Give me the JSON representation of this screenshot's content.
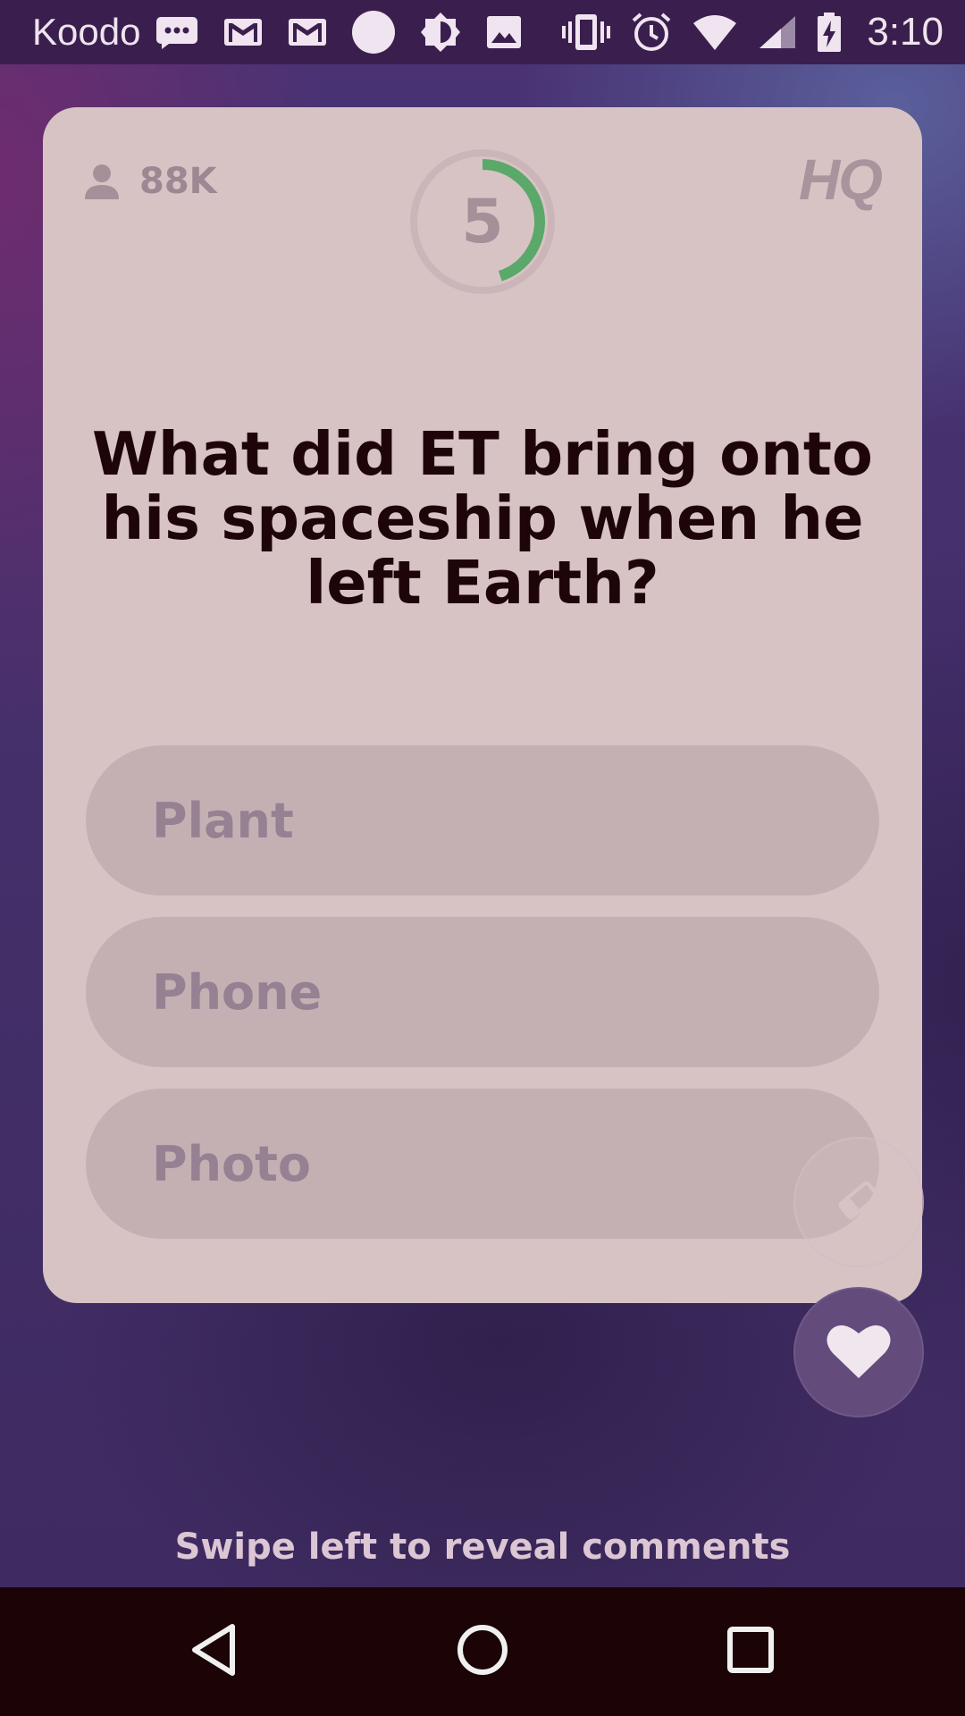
{
  "status_bar": {
    "carrier": "Koodo",
    "time": "3:10",
    "left_icons": [
      "message-icon",
      "gmail-icon",
      "gmail-icon",
      "circle-icon",
      "brightness-icon",
      "image-icon"
    ],
    "right_icons": [
      "vibrate-icon",
      "alarm-icon",
      "wifi-icon",
      "signal-icon",
      "battery-charging-icon"
    ]
  },
  "game": {
    "player_count": "88K",
    "timer_value": "5",
    "timer_progress": 0.45,
    "logo": "HQ",
    "question": "What did ET bring onto his spaceship when he left Earth?",
    "answers": [
      "Plant",
      "Phone",
      "Photo"
    ]
  },
  "swipe_hint": "Swipe left to reveal comments",
  "colors": {
    "card": "#d8c3c4",
    "answer": "#c4b0b3",
    "timer_ring": "#5aa86a",
    "question_text": "#1e0509"
  },
  "nav": {
    "buttons": [
      "back-icon",
      "home-icon",
      "recent-apps-icon"
    ]
  }
}
